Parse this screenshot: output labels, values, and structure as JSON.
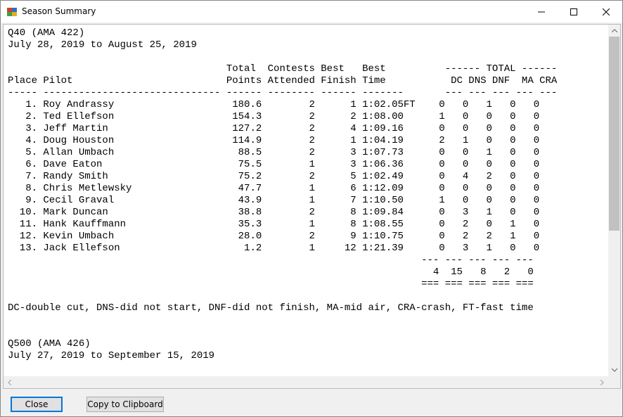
{
  "window": {
    "title": "Season Summary"
  },
  "report": {
    "lines": [
      "Q40 (AMA 422)",
      "July 28, 2019 to August 25, 2019",
      "",
      "                                     Total  Contests Best   Best          ------ TOTAL ------",
      "Place Pilot                          Points Attended Finish Time           DC DNS DNF  MA CRA",
      "----- ------------------------------ ------ -------- ------ -------       --- --- --- --- ---",
      "   1. Roy Andrassy                    180.6        2      1 1:02.05FT    0   0   1   0   0",
      "   2. Ted Ellefson                    154.3        2      2 1:08.00      1   0   0   0   0",
      "   3. Jeff Martin                     127.2        2      4 1:09.16      0   0   0   0   0",
      "   4. Doug Houston                    114.9        2      1 1:04.19      2   1   0   0   0",
      "   5. Allan Umbach                     88.5        2      3 1:07.73      0   0   1   0   0",
      "   6. Dave Eaton                       75.5        1      3 1:06.36      0   0   0   0   0",
      "   7. Randy Smith                      75.2        2      5 1:02.49      0   4   2   0   0",
      "   8. Chris Metlewsky                  47.7        1      6 1:12.09      0   0   0   0   0",
      "   9. Cecil Graval                     43.9        1      7 1:10.50      1   0   0   0   0",
      "  10. Mark Duncan                      38.8        2      8 1:09.84      0   3   1   0   0",
      "  11. Hank Kauffmann                   35.3        1      8 1:08.55      0   2   0   1   0",
      "  12. Kevin Umbach                     28.0        2      9 1:10.75      0   2   2   1   0",
      "  13. Jack Ellefson                     1.2        1     12 1:21.39      0   3   1   0   0",
      "                                                                      --- --- --- --- ---",
      "                                                                        4  15   8   2   0",
      "                                                                      === === === === ===",
      "",
      "DC-double cut, DNS-did not start, DNF-did not finish, MA-mid air, CRA-crash, FT-fast time",
      "",
      "",
      "Q500 (AMA 426)",
      "July 27, 2019 to September 15, 2019"
    ]
  },
  "buttons": {
    "close": "Close",
    "clipboard": "Copy to Clipboard"
  },
  "icons": {
    "app": "app-icon",
    "minimize": "minimize-icon",
    "maximize": "maximize-icon",
    "close": "close-icon"
  }
}
